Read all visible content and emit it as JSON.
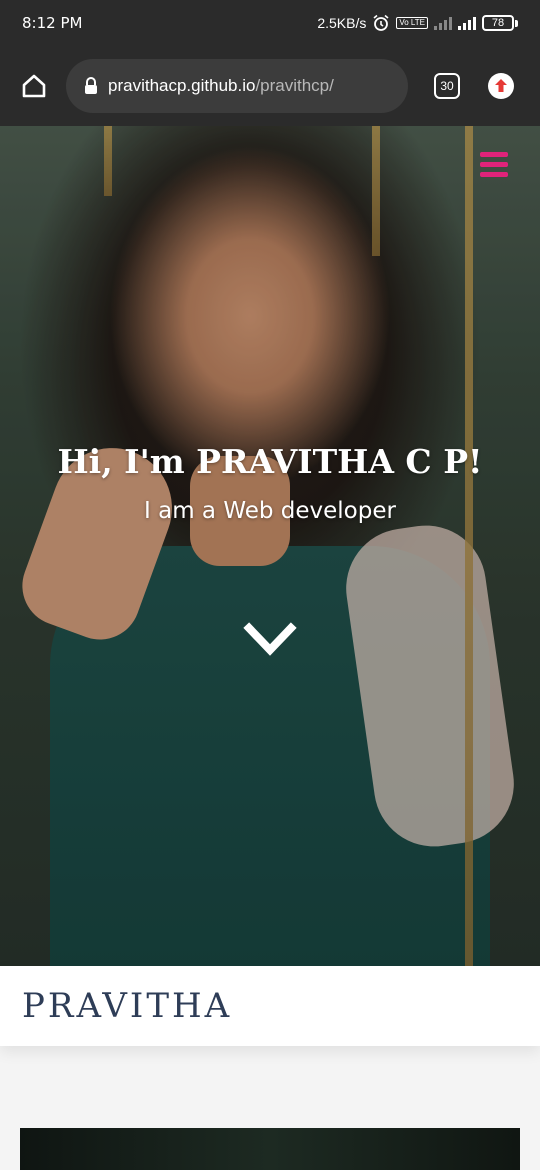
{
  "status_bar": {
    "time": "8:12 PM",
    "network_speed": "2.5KB/s",
    "alarm_icon": "alarm-icon",
    "volte_label": "Vo LTE",
    "battery_level": "78"
  },
  "browser": {
    "url_host": "pravithacp.github.io",
    "url_path": "/pravithcp/",
    "tab_count": "30",
    "home_icon": "home-icon",
    "lock_icon": "lock-icon",
    "update_icon": "update-icon"
  },
  "hero": {
    "title": "Hi, I'm PRAVITHA C P!",
    "subtitle": "I am a Web developer",
    "menu_color": "#e0237a",
    "scroll_icon": "chevron-down-icon"
  },
  "brand": {
    "name": "PRAVITHA",
    "color": "#2e3d57"
  }
}
